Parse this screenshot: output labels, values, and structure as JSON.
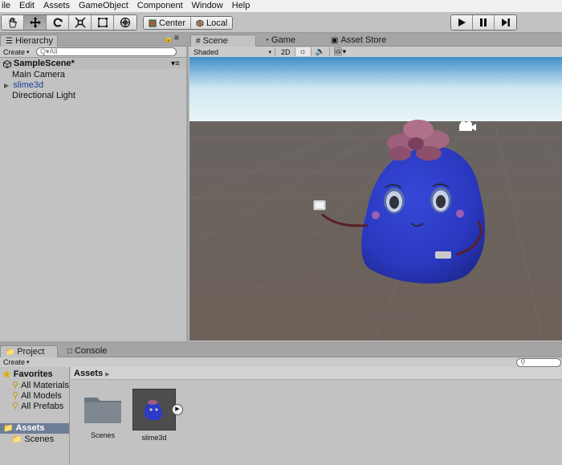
{
  "menubar": {
    "items": [
      "ile",
      "Edit",
      "Assets",
      "GameObject",
      "Component",
      "Window",
      "Help"
    ]
  },
  "toolbar": {
    "tools": [
      "hand-tool",
      "move-tool",
      "rotate-tool",
      "scale-tool",
      "rect-tool",
      "transform-tool"
    ],
    "active_tool": "move-tool",
    "pivot_label": "Center",
    "space_label": "Local",
    "play_controls": [
      "play",
      "pause",
      "step"
    ]
  },
  "hierarchy": {
    "tab_label": "Hierarchy",
    "create_label": "Create",
    "search_placeholder": "Q▾All",
    "scene_name": "SampleScene*",
    "items": [
      "Main Camera",
      "slime3d",
      "Directional Light"
    ],
    "selected_item_color": "#1a3f9e"
  },
  "scene_view": {
    "tabs": [
      "Scene",
      "Game",
      "Asset Store"
    ],
    "active_tab": "Scene",
    "shading_mode": "Shaded",
    "mode_2d_label": "2D",
    "character_color": "#2c3bc7",
    "leaf_color": "#9e5f7c",
    "sky_color": "#dfeff6",
    "ground_color": "#6e625a"
  },
  "project": {
    "tabs": [
      "Project",
      "Console"
    ],
    "active_tab": "Project",
    "create_label": "Create",
    "favorites_label": "Favorites",
    "favorites": [
      "All Materials",
      "All Models",
      "All Prefabs"
    ],
    "assets_root_label": "Assets",
    "assets_children": [
      "Scenes"
    ],
    "breadcrumb": "Assets",
    "assets": [
      {
        "name": "Scenes",
        "type": "folder"
      },
      {
        "name": "slime3d",
        "type": "model"
      }
    ]
  }
}
